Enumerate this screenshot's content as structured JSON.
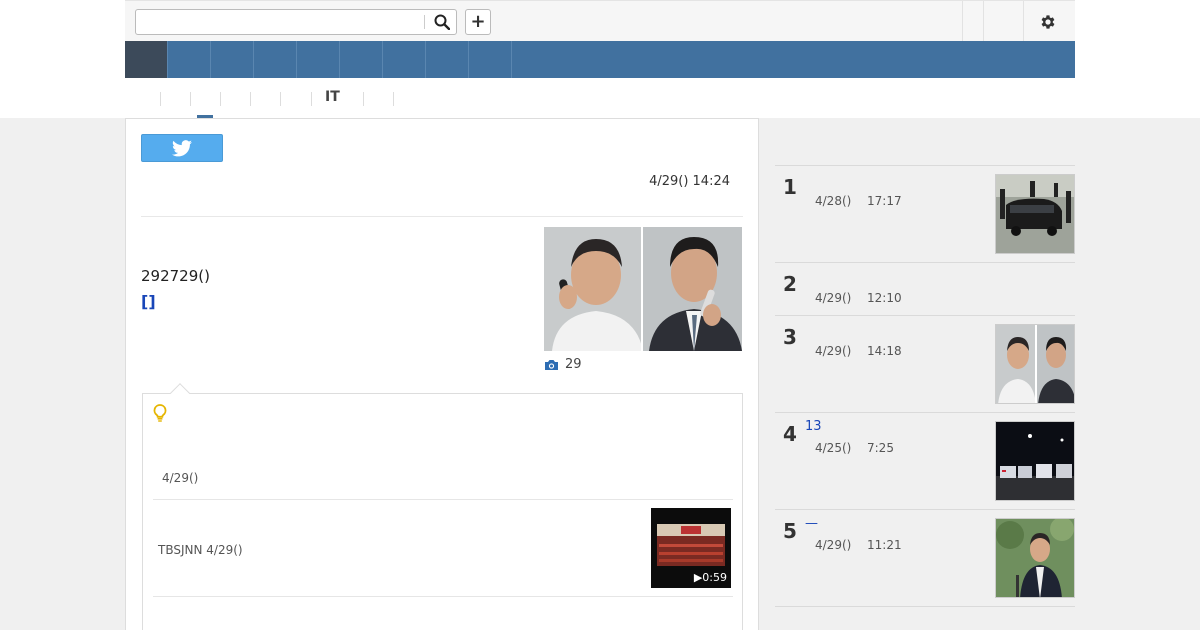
{
  "header": {
    "search": {
      "value": "",
      "placeholder": ""
    },
    "icons": {
      "search": "search-icon",
      "add": "plus-icon",
      "settings": "gear-icon"
    },
    "add_label": "+"
  },
  "colors": {
    "nav_blue": "#41719f",
    "nav_active": "#3c4a5a",
    "twitter": "#55acee",
    "link_blue": "#1946b8"
  },
  "nav": {
    "item_count": 9,
    "active_index": 0
  },
  "subnav": {
    "items": [
      "",
      "",
      "",
      "",
      "",
      "IT",
      "",
      ""
    ],
    "active_index": 1
  },
  "article": {
    "share_icon": "twitter-icon",
    "timestamp": "4/29() 14:24",
    "lead": "292729()",
    "brackets": "[]",
    "photo_caption": "29",
    "photo_icon": "camera-icon"
  },
  "infobox": {
    "icon": "lightbulb-icon",
    "date": "4/29()",
    "video_text": "TBSJNN 4/29()",
    "video_duration": "▶0:59"
  },
  "ranking": [
    {
      "rank": "1",
      "badge": "",
      "date": "4/28()",
      "time": "17:17",
      "has_thumb": true
    },
    {
      "rank": "2",
      "badge": "",
      "date": "4/29()",
      "time": "12:10",
      "has_thumb": false
    },
    {
      "rank": "3",
      "badge": "",
      "date": "4/29()",
      "time": "14:18",
      "has_thumb": true
    },
    {
      "rank": "4",
      "badge": "13",
      "date": "4/25()",
      "time": "7:25",
      "has_thumb": true
    },
    {
      "rank": "5",
      "badge": "—",
      "date": "4/29()",
      "time": "11:21",
      "has_thumb": true
    }
  ]
}
